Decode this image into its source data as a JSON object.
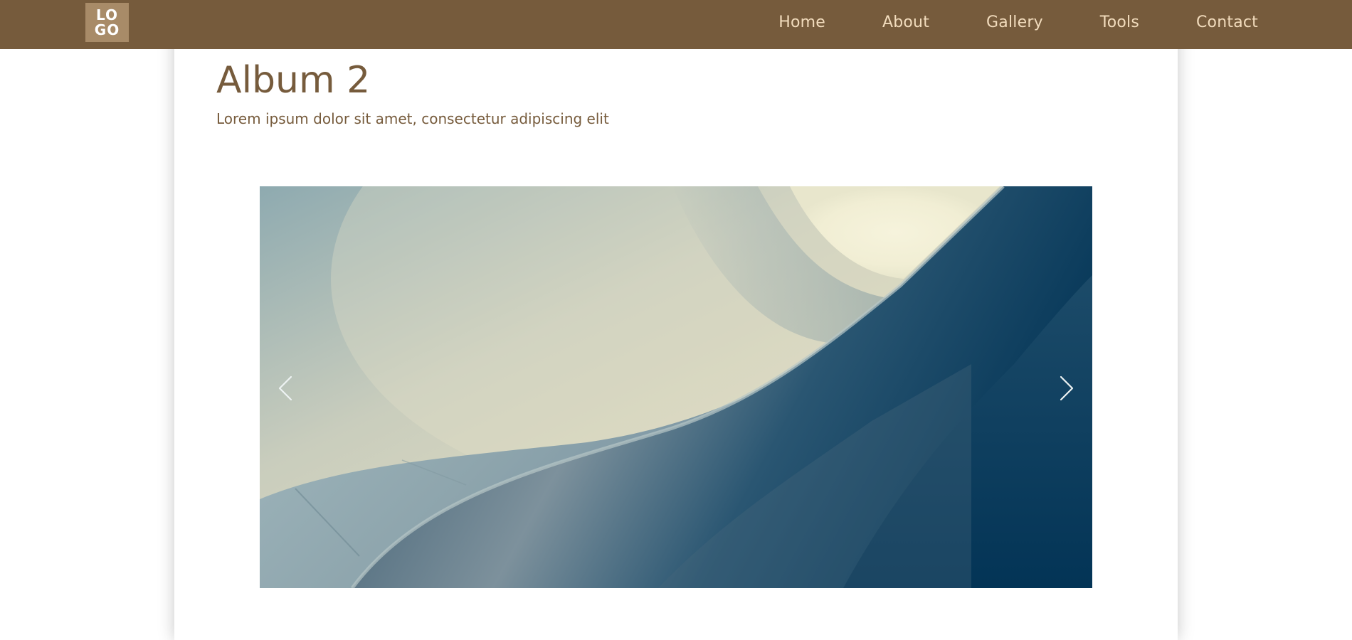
{
  "header": {
    "logo_line1": "LO",
    "logo_line2": "GO",
    "nav": [
      {
        "label": "Home"
      },
      {
        "label": "About"
      },
      {
        "label": "Gallery"
      },
      {
        "label": "Tools"
      },
      {
        "label": "Contact"
      }
    ]
  },
  "page": {
    "title": "Album 2",
    "subtitle": "Lorem ipsum dolor sit amet, consectetur adipiscing elit"
  },
  "slider": {
    "prev_icon": "chevron-left-icon",
    "next_icon": "chevron-right-icon"
  },
  "colors": {
    "header_bg": "#765b3c",
    "logo_bg": "#a88b68",
    "nav_text": "#f2dcbd",
    "heading_text": "#765b3c"
  }
}
